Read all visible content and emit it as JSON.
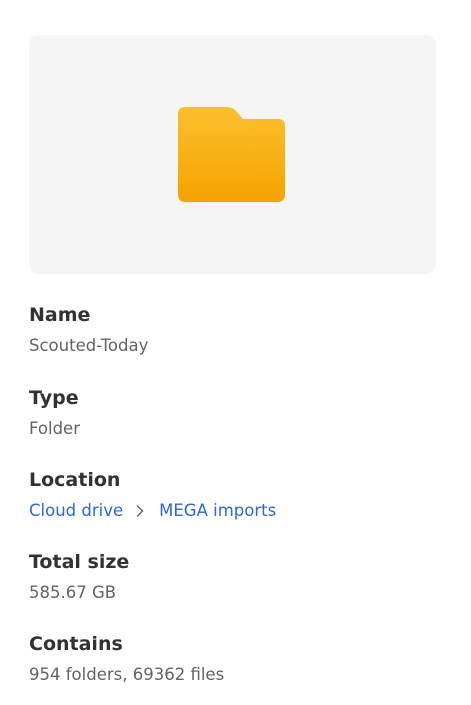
{
  "preview": {
    "icon": "folder-icon",
    "background": "#f5f5f5",
    "folder_color_top": "#fbc02d",
    "folder_color_bottom": "#f5a300"
  },
  "details": {
    "name": {
      "label": "Name",
      "value": "Scouted-Today"
    },
    "type": {
      "label": "Type",
      "value": "Folder"
    },
    "location": {
      "label": "Location",
      "path": [
        "Cloud drive",
        "MEGA imports"
      ],
      "separator_icon": "chevron-right-icon",
      "link_color": "#2e68d6"
    },
    "total_size": {
      "label": "Total size",
      "value": "585.67 GB"
    },
    "contains": {
      "label": "Contains",
      "value": "954 folders, 69362 files"
    }
  }
}
